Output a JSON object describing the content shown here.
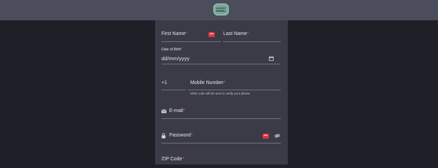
{
  "header": {
    "logo_line1": "LUCKY",
    "logo_line2": "REBEL"
  },
  "form": {
    "first_name": {
      "label": "First Name",
      "req": "*",
      "error_badge": "•••"
    },
    "last_name": {
      "label": "Last Name",
      "req": "*"
    },
    "dob": {
      "label": "Date of Birth",
      "req": "*",
      "placeholder": "dd/mm/yyyy"
    },
    "phone": {
      "prefix": "+1",
      "label": "Mobile Number",
      "req": "*",
      "hint": "SMS code will be sent to verify your phone"
    },
    "email": {
      "label": "E-mail",
      "req": "*"
    },
    "password": {
      "label": "Password",
      "req": "*",
      "error_badge": "•••"
    },
    "zip": {
      "label": "ZIP Code",
      "req": "*"
    }
  },
  "icons": [
    "calendar-icon",
    "email-icon",
    "lock-icon",
    "eye-off-icon"
  ],
  "colors": {
    "background": "#1f2027",
    "panel": "#3a3b46",
    "header": "#4b4d5b",
    "required": "#e25b6a",
    "error": "#e2353f"
  }
}
